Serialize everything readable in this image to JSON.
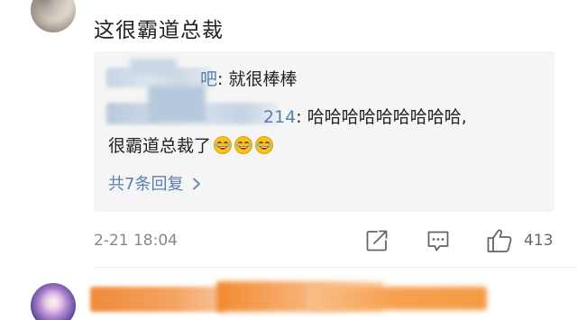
{
  "comment": {
    "text": "这很霸道总裁",
    "date": "2-21 18:04",
    "like_count": "413"
  },
  "replies": {
    "reply1": {
      "user_suffix": "吧",
      "text": ": 就很棒棒"
    },
    "reply2": {
      "user_suffix": "214",
      "text_line1": ": 哈哈哈哈哈哈哈哈哈,",
      "text_line2": "很霸道总裁了",
      "emoji_count": 3
    },
    "expand_label": "共7条回复",
    "expand_chevron": ">"
  },
  "actions": {
    "share_icon": "share-icon",
    "comment_icon": "comment-icon",
    "like_icon": "thumbs-up-icon"
  },
  "colors": {
    "link": "#5b7fad",
    "text": "#222222",
    "meta": "#888888",
    "reply_bg": "#f5f5f5"
  }
}
